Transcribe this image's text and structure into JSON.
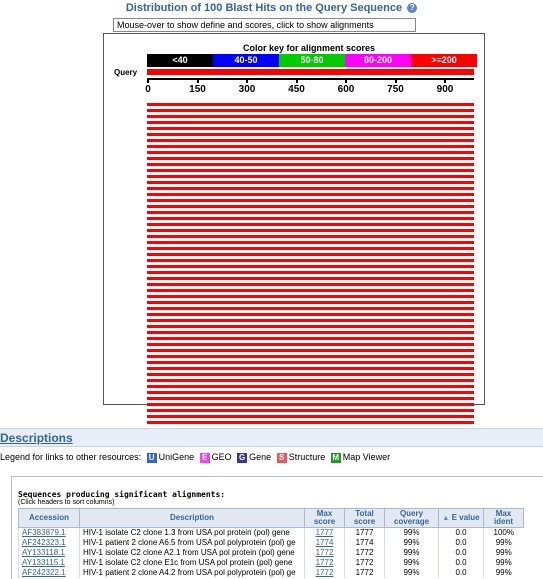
{
  "distribution": {
    "title": "Distribution of 100 Blast Hits on the Query Sequence",
    "mouseover_hint": "Mouse-over to show define and scores, click to show alignments",
    "color_key_title": "Color key for alignment scores",
    "color_key": [
      {
        "label": "<40",
        "color": "#000000"
      },
      {
        "label": "40-50",
        "color": "#0000ff"
      },
      {
        "label": "50-80",
        "color": "#00cc00"
      },
      {
        "label": "80-200",
        "color": "#ff00ff"
      },
      {
        "label": ">=200",
        "color": "#ff0000"
      }
    ],
    "query_label": "Query",
    "axis_ticks": [
      "0",
      "150",
      "300",
      "450",
      "600",
      "750",
      "900"
    ],
    "hit_color": "#ff0000",
    "hit_count_shown": 54
  },
  "descriptions": {
    "title": "Descriptions",
    "legend_prefix": "Legend for links to other resources:",
    "legend_items": [
      {
        "letter": "U",
        "label": "UniGene",
        "color": "#3366cc"
      },
      {
        "letter": "E",
        "label": "GEO",
        "color": "#ee44ee"
      },
      {
        "letter": "G",
        "label": "Gene",
        "color": "#3333aa"
      },
      {
        "letter": "S",
        "label": "Structure",
        "color": "#ee5555"
      },
      {
        "letter": "M",
        "label": "Map Viewer",
        "color": "#229922"
      }
    ],
    "heading": "Sequences producing significant alignments:",
    "subheading": "(Click headers to sort columns)",
    "columns": [
      "Accession",
      "Description",
      "Max score",
      "Total score",
      "Query coverage",
      "E value",
      "Max ident"
    ],
    "rows": [
      {
        "accession": "AF383879.1",
        "description": "HIV-1 isolate C2 clone 1.3 from USA pol protein (pol) gene",
        "max_score": "1777",
        "total_score": "1777",
        "coverage": "99%",
        "evalue": "0.0",
        "ident": "100%"
      },
      {
        "accession": "AF242323.1",
        "description": "HIV-1 patient 2 clone A6.5 from USA pol polyprotein (pol) ge",
        "max_score": "1774",
        "total_score": "1774",
        "coverage": "99%",
        "evalue": "0.0",
        "ident": "99%"
      },
      {
        "accession": "AY133118.1",
        "description": "HIV-1 isolate C2 clone A2.1 from USA pol protein (pol) gene",
        "max_score": "1772",
        "total_score": "1772",
        "coverage": "99%",
        "evalue": "0.0",
        "ident": "99%"
      },
      {
        "accession": "AY133115.1",
        "description": "HIV-1 isolate C2 clone E1c from USA pol protein (pol) gene",
        "max_score": "1772",
        "total_score": "1772",
        "coverage": "99%",
        "evalue": "0.0",
        "ident": "99%"
      },
      {
        "accession": "AF242322.1",
        "description": "HIV-1 patient 2 clone A4.2 from USA pol polyprotein (pol) ge",
        "max_score": "1772",
        "total_score": "1772",
        "coverage": "99%",
        "evalue": "0.0",
        "ident": "99%"
      }
    ]
  }
}
